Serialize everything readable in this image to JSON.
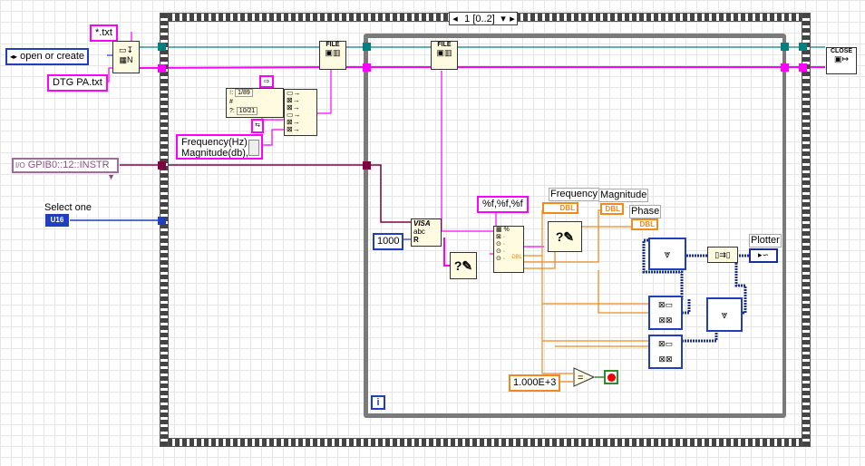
{
  "constants": {
    "pattern": "*.txt",
    "open_mode": "open or create",
    "file_name": "DTG PA.txt",
    "resource": "GPIB0::12::INSTR",
    "select_label": "Select one",
    "select_type": "U16",
    "byte_count": "1000",
    "format_string": "%f,%f,%f",
    "header_lines": [
      "Frequency(Hz),",
      "Magnitude(db),"
    ],
    "stop_value": "1.000E+3"
  },
  "case_selector": "1 [0..2]",
  "nodes": {
    "file_icon_label": "FILE",
    "close_label": "CLOSE",
    "visa_label": "VISA",
    "visa_sub": "abc",
    "visa_r": "R",
    "format_value": "1/89",
    "format_time": "10/21",
    "dbl_tag": "DBL"
  },
  "indicators": {
    "frequency": "Frequency",
    "magnitude": "Magnitude",
    "phase": "Phase",
    "plotter": "Plotter"
  },
  "loop_iteration": "i",
  "colors": {
    "string_wire": "#ff00ff",
    "refnum_wire": "#008080",
    "visa_wire": "#800040",
    "numeric_wire": "#f08a1f",
    "integer_wire": "#1f3fbf",
    "cluster_wire": "#1a2f8f"
  }
}
